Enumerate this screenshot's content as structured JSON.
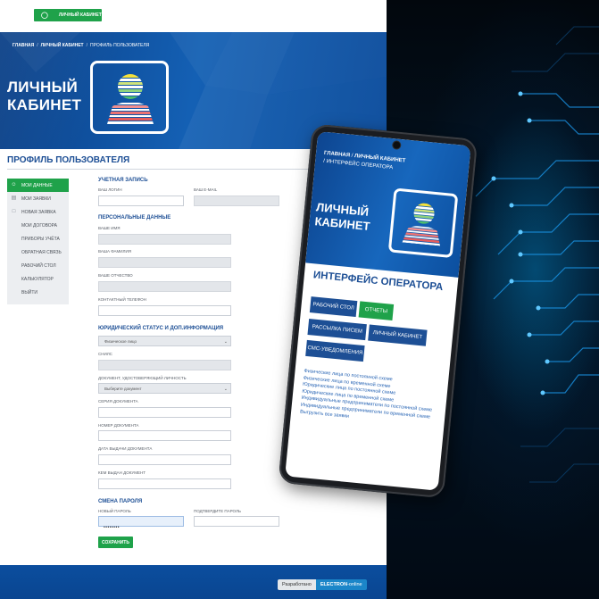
{
  "topbar": {
    "cabinet_button": "ЛИЧНЫЙ КАБИНЕТ"
  },
  "breadcrumbs": [
    {
      "label": "ГЛАВНАЯ",
      "bold": true
    },
    {
      "label": "ЛИЧНЫЙ КАБИНЕТ",
      "bold": true
    },
    {
      "label": "ПРОФИЛЬ ПОЛЬЗОВАТЕЛЯ",
      "bold": false
    }
  ],
  "hero": {
    "title_line1": "ЛИЧНЫЙ",
    "title_line2": "КАБИНЕТ"
  },
  "page_title": "ПРОФИЛЬ ПОЛЬЗОВАТЕЛЯ",
  "sidebar": {
    "items": [
      {
        "label": "МОИ ДАННЫЕ",
        "icon": "user-icon",
        "active": true
      },
      {
        "label": "МОИ ЗАЯВКИ",
        "icon": "list-icon",
        "active": false
      },
      {
        "label": "НОВАЯ ЗАЯВКА",
        "icon": "document-icon",
        "active": false
      },
      {
        "label": "МОИ ДОГОВОРА",
        "icon": "",
        "active": false
      },
      {
        "label": "ПРИБОРЫ УЧЁТА",
        "icon": "",
        "active": false
      },
      {
        "label": "ОБРАТНАЯ СВЯЗЬ",
        "icon": "",
        "active": false
      },
      {
        "label": "РАБОЧИЙ СТОЛ",
        "icon": "",
        "active": false
      },
      {
        "label": "КАЛЬКУЛЯТОР",
        "icon": "",
        "active": false
      },
      {
        "label": "ВЫЙТИ",
        "icon": "",
        "active": false
      }
    ]
  },
  "form": {
    "account_section": "УЧЕТНАЯ ЗАПИСЬ",
    "login_label": "ВАШ ЛОГИН",
    "email_label": "ВАШ E-MAIL",
    "personal_section": "ПЕРСОНАЛЬНЫЕ ДАННЫЕ",
    "name_label": "ВАШЕ ИМЯ",
    "surname_label": "ВАША ФАМИЛИЯ",
    "patronymic_label": "ВАШЕ ОТЧЕСТВО",
    "phone_label": "КОНТАКТНЫЙ ТЕЛЕФОН",
    "legal_section": "ЮРИДИЧЕСКИЙ СТАТУС И ДОП.ИНФОРМАЦИЯ",
    "legal_status_value": "Физическое лицо",
    "snils_label": "СНИЛС",
    "id_doc_label": "ДОКУМЕНТ, УДОСТОВЕРЯЮЩИЙ ЛИЧНОСТЬ",
    "id_doc_value": "Выберите документ",
    "doc_series_label": "СЕРИЯ ДОКУМЕНТА",
    "doc_number_label": "НОМЕР ДОКУМЕНТА",
    "doc_date_label": "ДАТА ВЫДАЧИ ДОКУМЕНТА",
    "doc_issuer_label": "КЕМ ВЫДАН ДОКУМЕНТ",
    "password_section": "СМЕНА ПАРОЛЯ",
    "new_password_label": "НОВЫЙ ПАРОЛЬ",
    "new_password_value": "••••••••",
    "confirm_password_label": "ПОДТВЕРДИТЕ ПАРОЛЬ",
    "save_button": "СОХРАНИТЬ"
  },
  "footer": {
    "developed_label": "Разработано",
    "brand": "ELECTRON",
    "brand_suffix": "-online"
  },
  "phone": {
    "crumb1": "ГЛАВНАЯ",
    "crumb2": "ЛИЧНЫЙ КАБИНЕТ",
    "crumb3": "ИНТЕРФЕЙС ОПЕРАТОРА",
    "title_line1": "ЛИЧНЫЙ",
    "title_line2": "КАБИНЕТ",
    "heading": "ИНТЕРФЕЙС ОПЕРАТОРА",
    "buttons": {
      "desktop": "РАБОЧИЙ СТОЛ",
      "reports": "ОТЧЕТЫ",
      "mailing": "РАССЫЛКА ПИСЕМ",
      "cabinet": "ЛИЧНЫЙ КАБИНЕТ",
      "sms": "СМС-УВЕДОМЛЕНИЯ"
    },
    "links": [
      "Физические лица по постоянной схеме",
      "Физические лица по временной схеме",
      "Юридические лица по постоянной схеме",
      "Юридические лица по временной схеме",
      "Индивидуальные предприниматели по постоянной схеме",
      "Индивидуальные предприниматели по временной схеме",
      "Выгрузить все заявки"
    ]
  },
  "colors": {
    "brand_blue": "#1d4f95",
    "accent_green": "#1fa24a",
    "hero_blue": "#1460b4"
  }
}
